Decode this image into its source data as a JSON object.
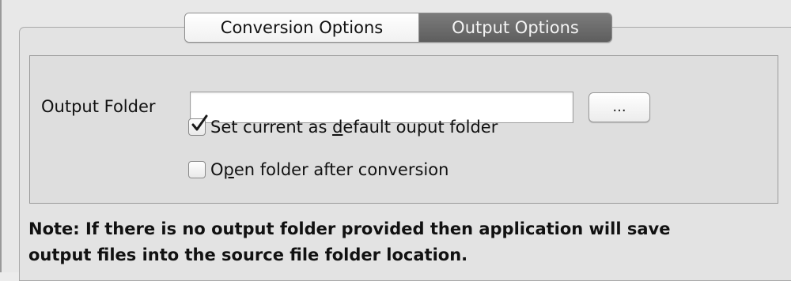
{
  "tabs": {
    "conversion_label": "Conversion Options",
    "output_label": "Output Options",
    "active": "Output Options"
  },
  "output": {
    "folder_label": "Output Folder",
    "folder_value": "",
    "browse_label": "...",
    "default_checkbox": {
      "prefix": "Set current as ",
      "underline": "d",
      "suffix": "efault ouput folder",
      "checked": true
    },
    "open_checkbox": {
      "prefix": "O",
      "underline": "p",
      "suffix": "en folder after conversion",
      "checked": false
    }
  },
  "note": {
    "line1": "Note: If there is no output folder provided then application will save",
    "line2": "output files into the source file folder location."
  }
}
